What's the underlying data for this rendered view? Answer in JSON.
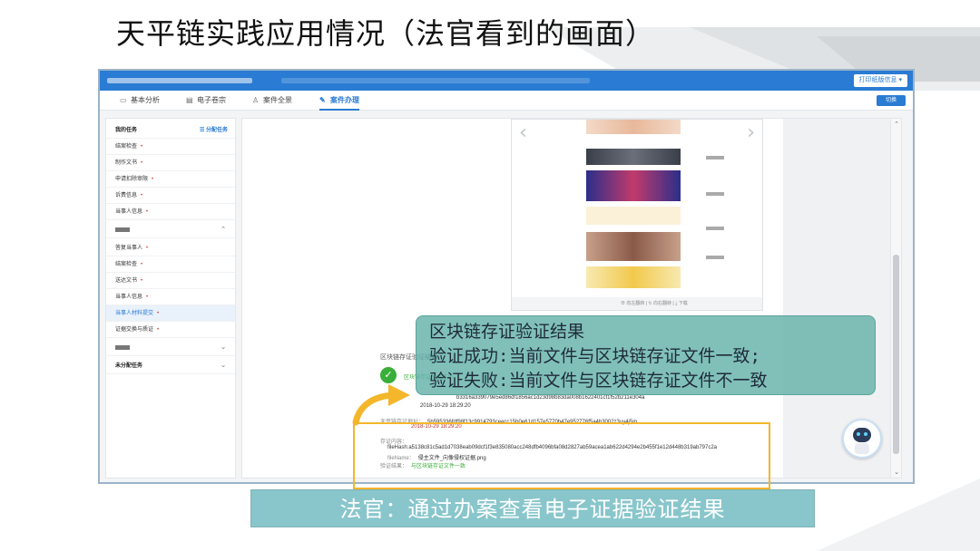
{
  "slide": {
    "title": "天平链实践应用情况（法官看到的画面）"
  },
  "app": {
    "top_button": "打印纸版信息 ▾",
    "tabs": [
      {
        "label": "基本分析",
        "icon": "chart-icon"
      },
      {
        "label": "电子卷宗",
        "icon": "folder-icon"
      },
      {
        "label": "案件全景",
        "icon": "people-icon"
      },
      {
        "label": "案件办理",
        "icon": "edit-icon"
      }
    ],
    "tab_action": "切换"
  },
  "sidebar": {
    "my_tasks": "我的任务",
    "assign": "☰ 分配任务",
    "group1": [
      "结案检查",
      "制作文书",
      "申请扣除审限",
      "诉费信息",
      "当事人信息"
    ],
    "group2": [
      "答复当事人",
      "结案检查",
      "送达文书",
      "当事人信息",
      "当事人材料提交",
      "证据交换与质证"
    ],
    "unassigned": "未分配任务"
  },
  "preview": {
    "toolbar": "⊕ 向左翻转  |  ↻ 向右翻转  |  ⤓ 下载"
  },
  "certificate": {
    "section_title": "区块链存证验证结果",
    "success_label": "区块链存证验证成功",
    "hash": "b3316a339079e5ed86df1856ac1d23d98b83da008b1622401cf1f52b211e304a",
    "time": "2018-10-29 18:29:20",
    "tianping_label": "天平链存证地址：",
    "tianping_hash": "5b595336fdf98f13c9914793ceecc15b0e61d157e5770b47e952776f5a4b3002z3uy4j5m",
    "tianping_time": "2018-10-29 18:29:20",
    "content_label": "存证内容：",
    "file_hash": "fileHash:a5138c81c5ad1d7038eab09dcf1f3e835080acc248dfb4096bfa08d2827ab59acea1ab622d4294e2b455f1e12d448b319ab797c2a",
    "file_name_label": "fileName：",
    "file_name": "侵主文件_向像侵权证据.png",
    "result_label": "验证结果：",
    "result": "与区块链存证文件一致"
  },
  "callout": {
    "line1": "区块链存证验证结果",
    "line2": "验证成功:当前文件与区块链存证文件一致;",
    "line3": "验证失败:当前文件与区块链存证文件不一致"
  },
  "banner": {
    "text": "法官：通过办案查看电子证据验证结果"
  },
  "colors": {
    "primary": "#2a7bd3",
    "success": "#3aae3a",
    "callout": "#64b2aa",
    "highlight": "#f4b62a"
  }
}
